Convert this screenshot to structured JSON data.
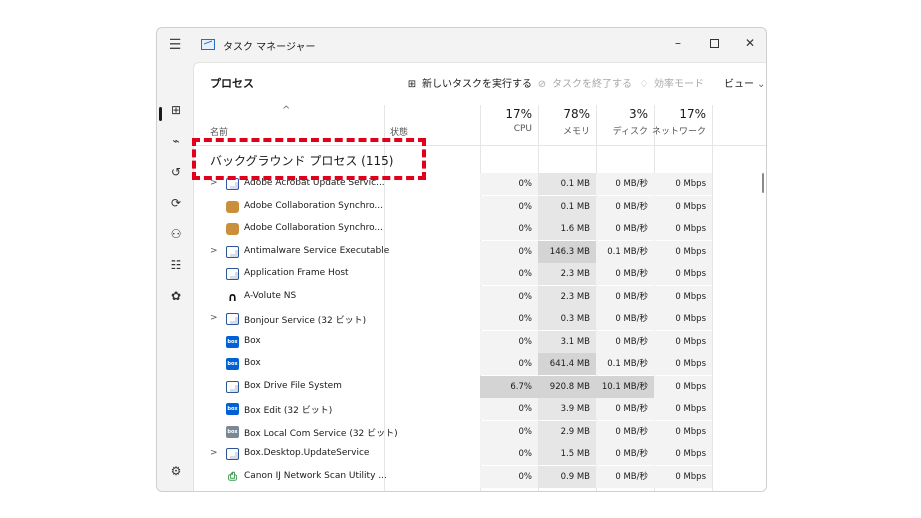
{
  "window": {
    "title": "タスク マネージャー",
    "controls": {
      "minimize": "–",
      "maximize": "",
      "close": "✕"
    }
  },
  "nav": {
    "menu_icon": "☰",
    "items": [
      {
        "name": "processes-icon",
        "glyph": "⊞"
      },
      {
        "name": "performance-icon",
        "glyph": "⌁"
      },
      {
        "name": "app-history-icon",
        "glyph": "↺"
      },
      {
        "name": "startup-icon",
        "glyph": "⟳"
      },
      {
        "name": "users-icon",
        "glyph": "⚇"
      },
      {
        "name": "details-icon",
        "glyph": "☷"
      },
      {
        "name": "services-icon",
        "glyph": "✿"
      }
    ],
    "settings_glyph": "⚙"
  },
  "page": {
    "title": "プロセス"
  },
  "commands": {
    "new_task": "新しいタスクを実行する",
    "end_task": "タスクを終了する",
    "efficiency": "効率モード",
    "view": "ビュー"
  },
  "columns": {
    "name": "名前",
    "status": "状態",
    "cpu_pct": "17%",
    "cpu": "CPU",
    "mem_pct": "78%",
    "mem": "メモリ",
    "disk_pct": "3%",
    "disk": "ディスク",
    "net_pct": "17%",
    "net": "ネットワーク"
  },
  "group": {
    "title": "バックグラウンド プロセス (115)"
  },
  "rows": [
    {
      "name": "Adobe Acrobat Update Servic...",
      "expand": ">",
      "icon": "frame",
      "icon_color": "#3b55a8",
      "cpu": "0%",
      "mem": "0.1 MB",
      "disk": "0 MB/秒",
      "net": "0 Mbps"
    },
    {
      "name": "Adobe Collaboration Synchro...",
      "expand": "",
      "icon": "pkg",
      "icon_color": "#c98f3a",
      "cpu": "0%",
      "mem": "0.1 MB",
      "disk": "0 MB/秒",
      "net": "0 Mbps"
    },
    {
      "name": "Adobe Collaboration Synchro...",
      "expand": "",
      "icon": "pkg",
      "icon_color": "#c98f3a",
      "cpu": "0%",
      "mem": "1.6 MB",
      "disk": "0 MB/秒",
      "net": "0 Mbps"
    },
    {
      "name": "Antimalware Service Executable",
      "expand": ">",
      "icon": "frame",
      "icon_color": "#2b5797",
      "cpu": "0%",
      "mem": "146.3 MB",
      "disk": "0.1 MB/秒",
      "net": "0 Mbps"
    },
    {
      "name": "Application Frame Host",
      "expand": "",
      "icon": "frame",
      "icon_color": "#2b5797",
      "cpu": "0%",
      "mem": "2.3 MB",
      "disk": "0 MB/秒",
      "net": "0 Mbps"
    },
    {
      "name": "A-Volute NS",
      "expand": "",
      "icon": "nahimic",
      "icon_color": "#111111",
      "cpu": "0%",
      "mem": "2.3 MB",
      "disk": "0 MB/秒",
      "net": "0 Mbps"
    },
    {
      "name": "Bonjour Service (32 ビット)",
      "expand": ">",
      "icon": "frame",
      "icon_color": "#2b5797",
      "cpu": "0%",
      "mem": "0.3 MB",
      "disk": "0 MB/秒",
      "net": "0 Mbps"
    },
    {
      "name": "Box",
      "expand": "",
      "icon": "box",
      "icon_color": "#0061d5",
      "cpu": "0%",
      "mem": "3.1 MB",
      "disk": "0 MB/秒",
      "net": "0 Mbps"
    },
    {
      "name": "Box",
      "expand": "",
      "icon": "box",
      "icon_color": "#0061d5",
      "cpu": "0%",
      "mem": "641.4 MB",
      "disk": "0.1 MB/秒",
      "net": "0 Mbps"
    },
    {
      "name": "Box Drive File System",
      "expand": "",
      "icon": "frame",
      "icon_color": "#2b5797",
      "cpu": "6.7%",
      "mem": "920.8 MB",
      "disk": "10.1 MB/秒",
      "net": "0 Mbps"
    },
    {
      "name": "Box Edit (32 ビット)",
      "expand": "",
      "icon": "box",
      "icon_color": "#0061d5",
      "cpu": "0%",
      "mem": "3.9 MB",
      "disk": "0 MB/秒",
      "net": "0 Mbps"
    },
    {
      "name": "Box Local Com Service (32 ビット)",
      "expand": "",
      "icon": "box",
      "icon_color": "#7a8794",
      "cpu": "0%",
      "mem": "2.9 MB",
      "disk": "0 MB/秒",
      "net": "0 Mbps"
    },
    {
      "name": "Box.Desktop.UpdateService",
      "expand": ">",
      "icon": "frame",
      "icon_color": "#2b5797",
      "cpu": "0%",
      "mem": "1.5 MB",
      "disk": "0 MB/秒",
      "net": "0 Mbps"
    },
    {
      "name": "Canon IJ Network Scan Utility ...",
      "expand": "",
      "icon": "scan",
      "icon_color": "#3a9a4a",
      "cpu": "0%",
      "mem": "0.9 MB",
      "disk": "0 MB/秒",
      "net": "0 Mbps"
    }
  ],
  "colors": {
    "highlight": "#e0001b",
    "heat_low": "#f3f3f3",
    "heat_mid": "#e6e6e6",
    "heat_high": "#d4d4d4"
  }
}
